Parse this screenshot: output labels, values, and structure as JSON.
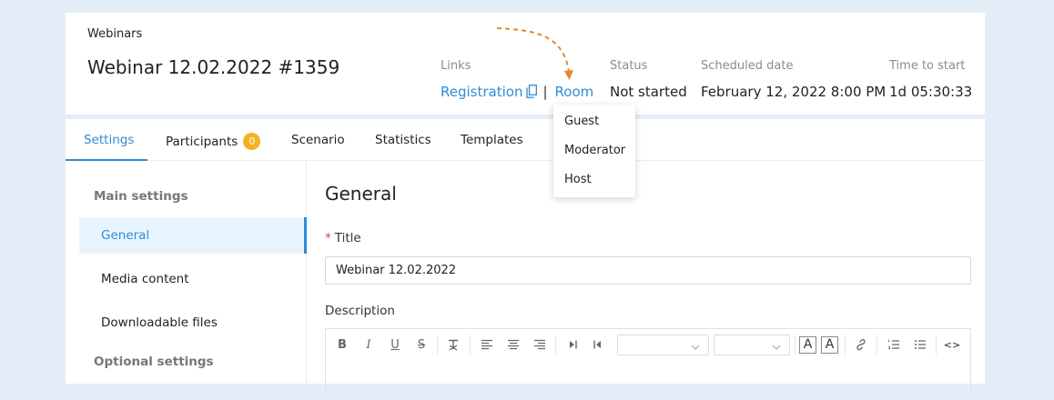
{
  "header": {
    "breadcrumb": "Webinars",
    "title": "Webinar 12.02.2022 #1359",
    "links_label": "Links",
    "registration_link": "Registration",
    "separator": "|",
    "room_link": "Room",
    "status_label": "Status",
    "status_value": "Not started",
    "scheduled_label": "Scheduled date",
    "scheduled_value": "February 12, 2022 8:00 PM",
    "time_label": "Time to start",
    "time_value": "1d 05:30:33"
  },
  "room_dropdown": {
    "items": [
      "Guest",
      "Moderator",
      "Host"
    ]
  },
  "tabs": [
    {
      "label": "Settings",
      "active": true
    },
    {
      "label": "Participants",
      "badge": "0"
    },
    {
      "label": "Scenario"
    },
    {
      "label": "Statistics"
    },
    {
      "label": "Templates"
    }
  ],
  "sidebar": {
    "main_heading": "Main settings",
    "items": [
      {
        "label": "General",
        "active": true
      },
      {
        "label": "Media content"
      },
      {
        "label": "Downloadable files"
      }
    ],
    "optional_heading": "Optional settings"
  },
  "general": {
    "section_title": "General",
    "title_label": "Title",
    "required_mark": "*",
    "title_value": "Webinar 12.02.2022",
    "description_label": "Description"
  },
  "toolbar": {
    "bold": "B",
    "italic": "I",
    "underline": "U",
    "strike": "S",
    "font_color": "A",
    "bg_color": "A",
    "code": "<>"
  },
  "colors": {
    "accent": "#2d8cd6",
    "badge": "#f4b223",
    "arrow": "#e08a2e",
    "background": "#e4edf7"
  }
}
